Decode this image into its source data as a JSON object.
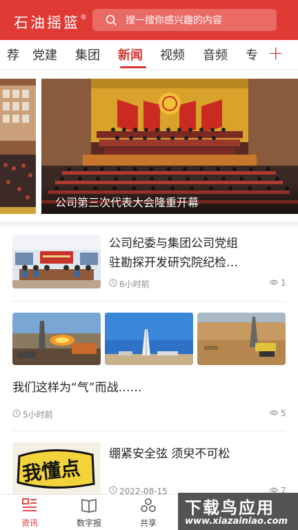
{
  "header": {
    "logo": "石油摇篮",
    "logo_mark": "®",
    "search_placeholder": "搜一搜你感兴趣的内容"
  },
  "tabs": [
    {
      "label": "荐"
    },
    {
      "label": "党建"
    },
    {
      "label": "集团"
    },
    {
      "label": "新闻",
      "active": true
    },
    {
      "label": "视频"
    },
    {
      "label": "音频"
    },
    {
      "label": "专"
    }
  ],
  "tabs_add_label": "+",
  "banner": {
    "caption": "公司第三次代表大会隆重开幕"
  },
  "articles": [
    {
      "title_line1": "公司纪委与集团公司党组",
      "title_line2": "驻勘探开发研究院纪检…",
      "time": "6小时前",
      "views": "1"
    },
    {
      "title": "我们这样为“气”而战……",
      "time": "5小时前",
      "views": "5"
    },
    {
      "title": "绷紧安全弦 须臾不可松",
      "time": "2022-08-15",
      "views": "7",
      "thumb_text": "我懂点"
    }
  ],
  "bottom_nav": [
    {
      "label": "资讯",
      "icon": "news-icon",
      "active": true
    },
    {
      "label": "数字报",
      "icon": "newspaper-icon"
    },
    {
      "label": "共享",
      "icon": "share-icon"
    }
  ],
  "watermark": {
    "top": "下载鸟应用",
    "bottom": "www.xiazainiao.com"
  },
  "colors": {
    "brand_red": "#e03a35",
    "active_red": "#d8332e"
  }
}
